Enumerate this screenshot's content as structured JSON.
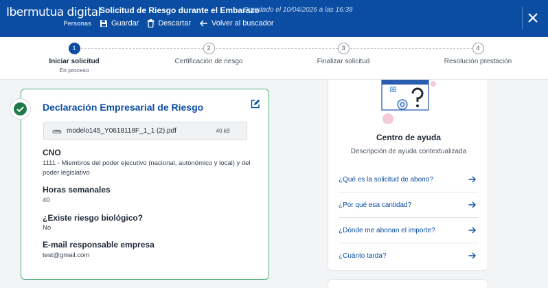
{
  "header": {
    "logo_text": "Ibermutua digital",
    "logo_sub": "Personas",
    "title": "Solicitud de Riesgo durante el Embarazo",
    "saved_status": "Guardado el 10/04/2026 a las 16:38",
    "actions": [
      {
        "label": "Guardar",
        "icon": "save-icon"
      },
      {
        "label": "Descartar",
        "icon": "trash-icon"
      },
      {
        "label": "Volver al buscador",
        "icon": "back-arrow-icon"
      }
    ],
    "close_icon": "close-icon"
  },
  "stepper": {
    "steps": [
      {
        "number": "1",
        "label": "Iniciar solicitud",
        "sub": "En proceso",
        "active": true
      },
      {
        "number": "2",
        "label": "Certificación de riesgo",
        "sub": "",
        "active": false
      },
      {
        "number": "3",
        "label": "Finalizar solicitud",
        "sub": "",
        "active": false
      },
      {
        "number": "4",
        "label": "Resolución prestación",
        "sub": "",
        "active": false
      }
    ]
  },
  "declaration": {
    "title": "Declaración Empresarial de Riesgo",
    "file": {
      "name": "modelo145_Y0618118F_1_1 (2).pdf",
      "size": "40 kB"
    },
    "fields": [
      {
        "label": "CNO",
        "value": "1111 - Miembros del poder ejecutivo (nacional, autonómico y local) y del poder legislativo"
      },
      {
        "label": "Horas semanales",
        "value": "40"
      },
      {
        "label": "¿Existe riesgo biológico?",
        "value": "No"
      },
      {
        "label": "E-mail responsable empresa",
        "value": "test@gmail.com"
      }
    ]
  },
  "help": {
    "title": "Centro de ayuda",
    "description": "Descripción de ayuda contextualizada",
    "links": [
      "¿Qué es la solicitud de abono?",
      "¿Por qué esa cantidad?",
      "¿Dónde me abonan el importe?",
      "¿Cuánto tarda?"
    ]
  },
  "colors": {
    "brand_blue": "#0a4da2",
    "success_green": "#1f7a4a",
    "card_border_green": "#4caf78"
  }
}
